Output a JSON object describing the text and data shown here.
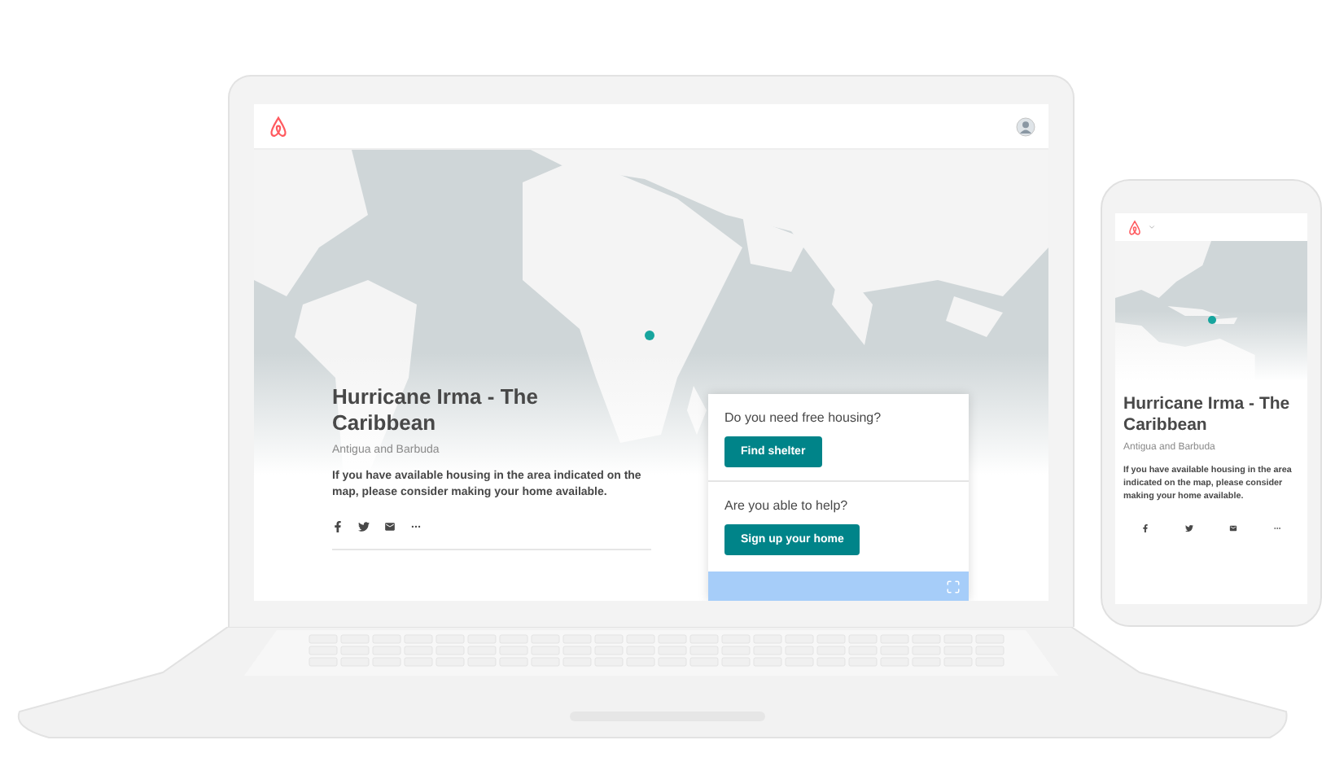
{
  "laptop": {
    "title": "Hurricane Irma - The Caribbean",
    "subtitle": "Antigua and Barbuda",
    "message": "If you have available housing in the area indicated on the map, please consider making your home available.",
    "card": [
      {
        "question": "Do you need free housing?",
        "button": "Find shelter"
      },
      {
        "question": "Are you able to help?",
        "button": "Sign up your home"
      }
    ]
  },
  "phone": {
    "title": "Hurricane Irma - The Caribbean",
    "subtitle": "Antigua and Barbuda",
    "message": "If you have available housing in the area indicated on the map, please consider making your home available."
  }
}
